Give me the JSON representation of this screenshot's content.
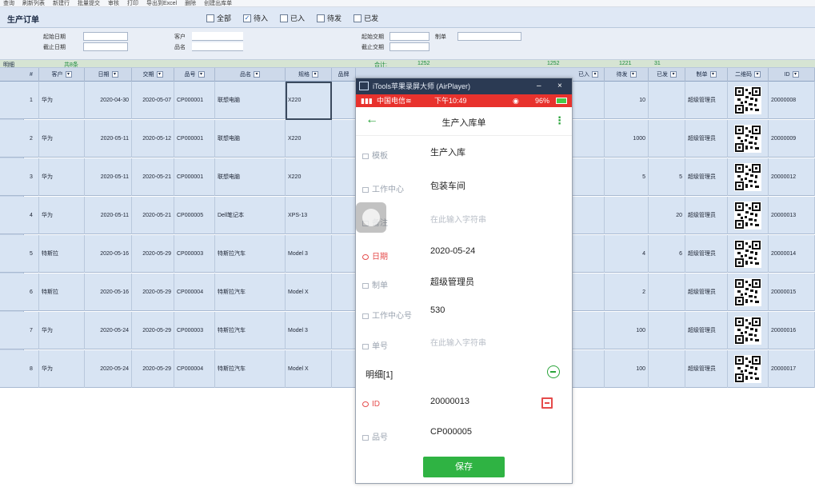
{
  "toolbar": {
    "items": [
      "查询",
      "刷新列表",
      "新建行",
      "批量提交",
      "审核",
      "打印",
      "导出到Excel",
      "删除",
      "创建出库单"
    ]
  },
  "order": {
    "title": "生产订单",
    "checkboxes": [
      {
        "label": "全部",
        "checked": false
      },
      {
        "label": "待入",
        "checked": true
      },
      {
        "label": "已入",
        "checked": false
      },
      {
        "label": "待发",
        "checked": false
      },
      {
        "label": "已发",
        "checked": false
      }
    ]
  },
  "filters": {
    "start_date": "起始日期",
    "end_date": "截止日期",
    "customer": "客户",
    "product_name": "品名",
    "start_delivery": "起始交期",
    "end_delivery": "截止交期",
    "maker": "制单"
  },
  "summary": {
    "label": "明细",
    "count": "共8条",
    "total_label": "合计:",
    "total1": "1252",
    "total2": "1252",
    "total3": "1221",
    "total4": "31"
  },
  "columns": [
    "#",
    "客户",
    "日期",
    "交期",
    "品号",
    "品名",
    "规格",
    "品牌",
    "数量",
    "单位",
    "工作中心",
    "入库",
    "已入",
    "待发",
    "已发",
    "制单",
    "二维码",
    "ID"
  ],
  "rows": [
    {
      "n": "1",
      "customer": "华为",
      "date": "2020-04-30",
      "delivery": "2020-05-07",
      "code": "CP000001",
      "name": "联想电脑",
      "spec": "X220",
      "pending": "10",
      "shipped": "",
      "maker": "超级管理员",
      "id": "20000008"
    },
    {
      "n": "2",
      "customer": "华为",
      "date": "2020-05-11",
      "delivery": "2020-05-12",
      "code": "CP000001",
      "name": "联想电脑",
      "spec": "X220",
      "pending": "1000",
      "shipped": "",
      "maker": "超级管理员",
      "id": "20000009"
    },
    {
      "n": "3",
      "customer": "华为",
      "date": "2020-05-11",
      "delivery": "2020-05-21",
      "code": "CP000001",
      "name": "联想电脑",
      "spec": "X220",
      "pending": "5",
      "shipped": "5",
      "maker": "超级管理员",
      "id": "20000012"
    },
    {
      "n": "4",
      "customer": "华为",
      "date": "2020-05-11",
      "delivery": "2020-05-21",
      "code": "CP000005",
      "name": "Dell笔记本",
      "spec": "XPS-13",
      "pending": "",
      "shipped": "20",
      "maker": "超级管理员",
      "id": "20000013"
    },
    {
      "n": "5",
      "customer": "特斯拉",
      "date": "2020-05-16",
      "delivery": "2020-05-29",
      "code": "CP000003",
      "name": "特斯拉汽车",
      "spec": "Model 3",
      "pending": "4",
      "shipped": "6",
      "maker": "超级管理员",
      "id": "20000014"
    },
    {
      "n": "6",
      "customer": "特斯拉",
      "date": "2020-05-16",
      "delivery": "2020-05-29",
      "code": "CP000004",
      "name": "特斯拉汽车",
      "spec": "Model X",
      "pending": "2",
      "shipped": "",
      "maker": "超级管理员",
      "id": "20000015"
    },
    {
      "n": "7",
      "customer": "华为",
      "date": "2020-05-24",
      "delivery": "2020-05-29",
      "code": "CP000003",
      "name": "特斯拉汽车",
      "spec": "Model 3",
      "pending": "100",
      "shipped": "",
      "maker": "超级管理员",
      "id": "20000016"
    },
    {
      "n": "8",
      "customer": "华为",
      "date": "2020-05-24",
      "delivery": "2020-05-29",
      "code": "CP000004",
      "name": "特斯拉汽车",
      "spec": "Model X",
      "pending": "100",
      "shipped": "",
      "maker": "超级管理员",
      "id": "20000017"
    }
  ],
  "phone": {
    "window_title": "iTools苹果录屏大师 (AirPlayer)",
    "min": "–",
    "close": "×",
    "carrier": "中国电信",
    "time": "下午10:49",
    "battery": "96%",
    "page_title": "生产入库单",
    "back": "←",
    "menu": "⋮",
    "fields": [
      {
        "label": "模板",
        "value": "生产入库",
        "placeholder": ""
      },
      {
        "label": "工作中心",
        "value": "包装车间",
        "placeholder": ""
      },
      {
        "label": "备注",
        "value": "",
        "placeholder": "在此输入字符串"
      },
      {
        "label": "日期",
        "value": "2020-05-24",
        "placeholder": ""
      },
      {
        "label": "制单",
        "value": "超级管理员",
        "placeholder": ""
      },
      {
        "label": "工作中心号",
        "value": "530",
        "placeholder": ""
      },
      {
        "label": "单号",
        "value": "",
        "placeholder": "在此输入字符串"
      }
    ],
    "detail_title": "明细[1]",
    "detail_fields": [
      {
        "label": "ID",
        "value": "20000013"
      },
      {
        "label": "品号",
        "value": "CP000005"
      }
    ],
    "save": "保存"
  },
  "colors": {
    "grid_row": "#d8e4f3",
    "header": "#cdd9ea",
    "phone_status": "#e8322d",
    "accent_green": "#2fb343"
  }
}
